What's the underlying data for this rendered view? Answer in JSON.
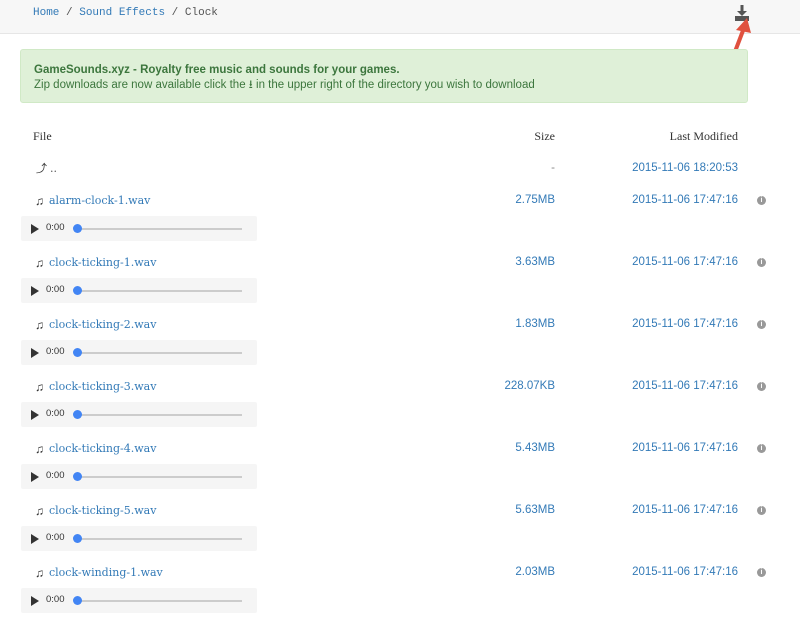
{
  "breadcrumb": {
    "items": [
      "Home",
      "Sound Effects"
    ],
    "current": "Clock",
    "separator": "/"
  },
  "alert": {
    "title": "GameSounds.xyz - Royalty free music and sounds for your games.",
    "text_before": "Zip downloads are now available click the",
    "text_after": "in the upper right of the directory you wish to download"
  },
  "table": {
    "headers": {
      "file": "File",
      "size": "Size",
      "modified": "Last Modified"
    },
    "parent": {
      "name": "..",
      "size": "-",
      "modified": "2015-11-06 18:20:53"
    },
    "files": [
      {
        "name": "alarm-clock-1.wav",
        "size": "2.75MB",
        "modified": "2015-11-06 17:47:16",
        "time": "0:00"
      },
      {
        "name": "clock-ticking-1.wav",
        "size": "3.63MB",
        "modified": "2015-11-06 17:47:16",
        "time": "0:00"
      },
      {
        "name": "clock-ticking-2.wav",
        "size": "1.83MB",
        "modified": "2015-11-06 17:47:16",
        "time": "0:00"
      },
      {
        "name": "clock-ticking-3.wav",
        "size": "228.07KB",
        "modified": "2015-11-06 17:47:16",
        "time": "0:00"
      },
      {
        "name": "clock-ticking-4.wav",
        "size": "5.43MB",
        "modified": "2015-11-06 17:47:16",
        "time": "0:00"
      },
      {
        "name": "clock-ticking-5.wav",
        "size": "5.63MB",
        "modified": "2015-11-06 17:47:16",
        "time": "0:00"
      },
      {
        "name": "clock-winding-1.wav",
        "size": "2.03MB",
        "modified": "2015-11-06 17:47:16",
        "time": "0:00"
      }
    ]
  }
}
